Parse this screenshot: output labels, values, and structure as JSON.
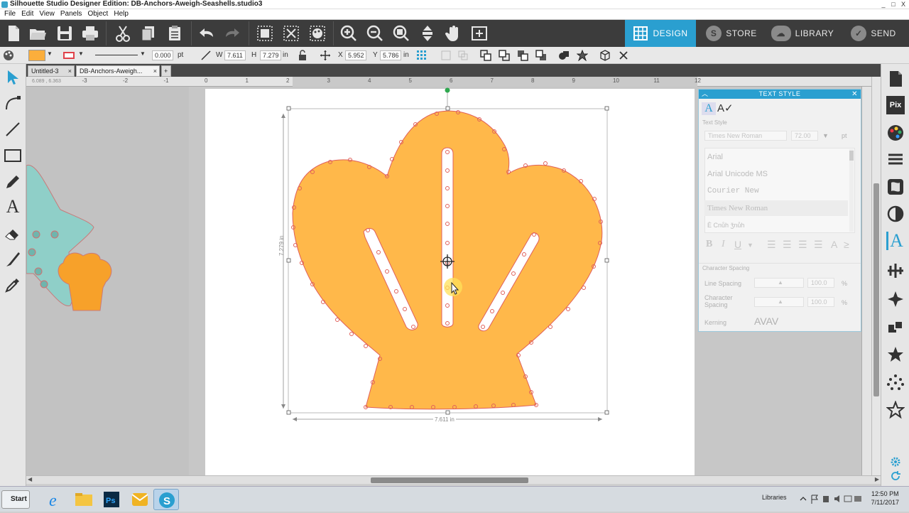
{
  "window": {
    "title": "Silhouette Studio Designer Edition: DB-Anchors-Aweigh-Seashells.studio3",
    "controls": [
      "_",
      "□",
      "X"
    ]
  },
  "menu": [
    "File",
    "Edit",
    "View",
    "Panels",
    "Object",
    "Help"
  ],
  "nav_tabs": [
    {
      "label": "DESIGN",
      "active": true,
      "icon": "grid-icon"
    },
    {
      "label": "STORE",
      "active": false,
      "icon": "s-logo-icon"
    },
    {
      "label": "LIBRARY",
      "active": false,
      "icon": "cloud-icon"
    },
    {
      "label": "SEND",
      "active": false,
      "icon": "check-icon"
    }
  ],
  "propbar": {
    "fill_color": "#FBAE3C",
    "line_color": "#E0424A",
    "line_width": "0.000",
    "line_unit": "pt",
    "w_label": "W",
    "w_value": "7.611",
    "h_label": "H",
    "h_value": "7.279",
    "size_unit": "in",
    "x_label": "X",
    "x_value": "5.952",
    "y_label": "Y",
    "y_value": "5.786"
  },
  "doc_tabs": [
    {
      "label": "Untitled-3"
    },
    {
      "label": "DB-Anchors-Aweigh..."
    }
  ],
  "doc_tab_add": "+",
  "ruler_coords": "6.089 , 6.363",
  "ruler_ticks": [
    "-3",
    "-2",
    "-1",
    "0",
    "1",
    "2",
    "3",
    "4",
    "5",
    "6",
    "7",
    "8",
    "9",
    "10",
    "11",
    "12"
  ],
  "selection": {
    "width_label": "7.611 in",
    "height_label": "7.279 in"
  },
  "colors": {
    "shell_fill": "#FFB84A",
    "shell_stroke": "#E0605A",
    "starfish_fill": "#8FCFC8",
    "small_shell_fill": "#F7A12A",
    "accent": "#2A9FD0"
  },
  "text_style": {
    "title": "TEXT STYLE",
    "section_text_style": "Text Style",
    "font_name": "Times New Roman",
    "font_size": "72.00",
    "font_unit": "pt",
    "fonts": [
      "Arial",
      "Arial Unicode MS",
      "Courier New",
      "Times New Roman",
      "Ѐ Cnůh ǯnůh"
    ],
    "selected_font_index": 3,
    "section_char_spacing": "Character Spacing",
    "line_spacing_label": "Line Spacing",
    "line_spacing_value": "100.0",
    "char_spacing_label": "Character Spacing",
    "char_spacing_value": "100.0",
    "percent": "%",
    "kerning_label": "Kerning",
    "kerning_sample": "AVAV",
    "bold": "B",
    "italic": "I",
    "underline": "U"
  },
  "taskbar": {
    "start_label": "Start",
    "libraries_label": "Libraries",
    "time": "12:50 PM",
    "date": "7/11/2017"
  }
}
